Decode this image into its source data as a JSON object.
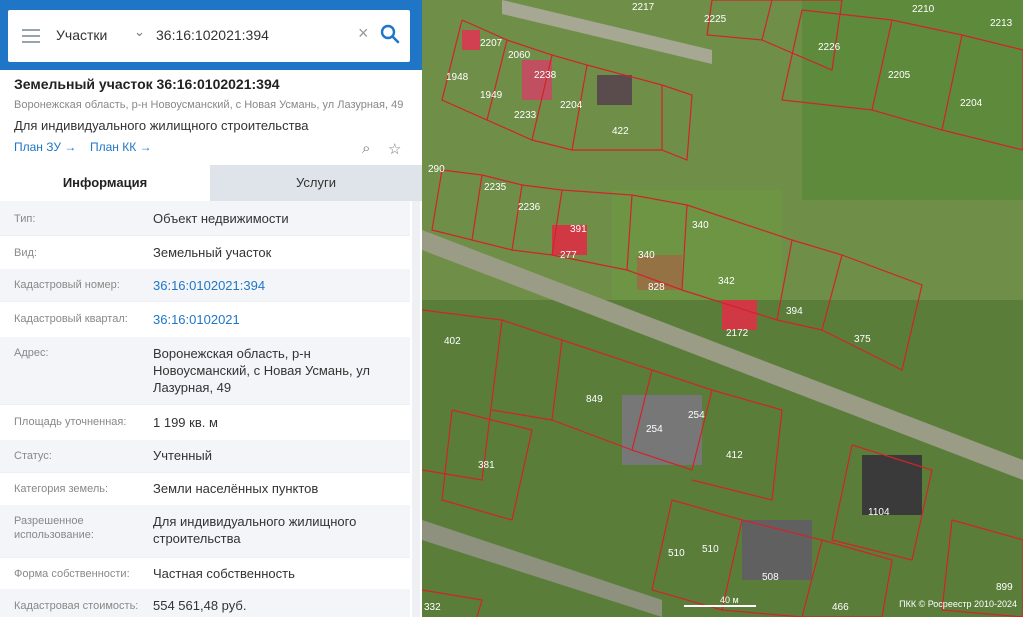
{
  "search": {
    "layer": "Участки",
    "value": "36:16:102021:394"
  },
  "card": {
    "title": "Земельный участок 36:16:0102021:394",
    "address": "Воронежская область, р-н Новоусманский, с Новая Усмань, ул Лазурная, 49",
    "use": "Для индивидуального жилищного строительства",
    "links": {
      "plan_zu": "План ЗУ →",
      "plan_kk": "План КК →"
    }
  },
  "tabs": {
    "info": "Информация",
    "services": "Услуги"
  },
  "info": [
    {
      "label": "Тип:",
      "value": "Объект недвижимости"
    },
    {
      "label": "Вид:",
      "value": "Земельный участок"
    },
    {
      "label": "Кадастровый номер:",
      "value": "36:16:0102021:394"
    },
    {
      "label": "Кадастровый квартал:",
      "value": "36:16:0102021"
    },
    {
      "label": "Адрес:",
      "value": "Воронежская область, р-н Новоусманский, с Новая Усмань, ул Лазурная, 49"
    },
    {
      "label": "Площадь уточненная:",
      "value": "1 199 кв. м"
    },
    {
      "label": "Статус:",
      "value": "Учтенный"
    },
    {
      "label": "Категория земель:",
      "value": "Земли населённых пунктов"
    },
    {
      "label": "Разрешенное использование:",
      "value": "Для индивидуального жилищного строительства"
    },
    {
      "label": "Форма собственности:",
      "value": "Частная собственность"
    },
    {
      "label": "Кадастровая стоимость:",
      "value": "554 561,48 руб."
    }
  ],
  "map": {
    "parcels": [
      "2207",
      "2217",
      "2225",
      "2210",
      "2213",
      "2226",
      "2205",
      "2204",
      "2060",
      "2238",
      "1948",
      "1949",
      "2233",
      "2204",
      "422",
      "290",
      "2235",
      "2236",
      "391",
      "340",
      "342",
      "828",
      "394",
      "375",
      "402",
      "2172",
      "849",
      "254",
      "254",
      "412",
      "381",
      "1104",
      "510",
      "510",
      "508",
      "466",
      "899",
      "332",
      "277",
      "340"
    ],
    "scale": "40 м",
    "copyright": "ПКК © Росреестр 2010-2024"
  },
  "colors": {
    "accent": "#1f76c7",
    "parcel_line": "#d2232a"
  }
}
